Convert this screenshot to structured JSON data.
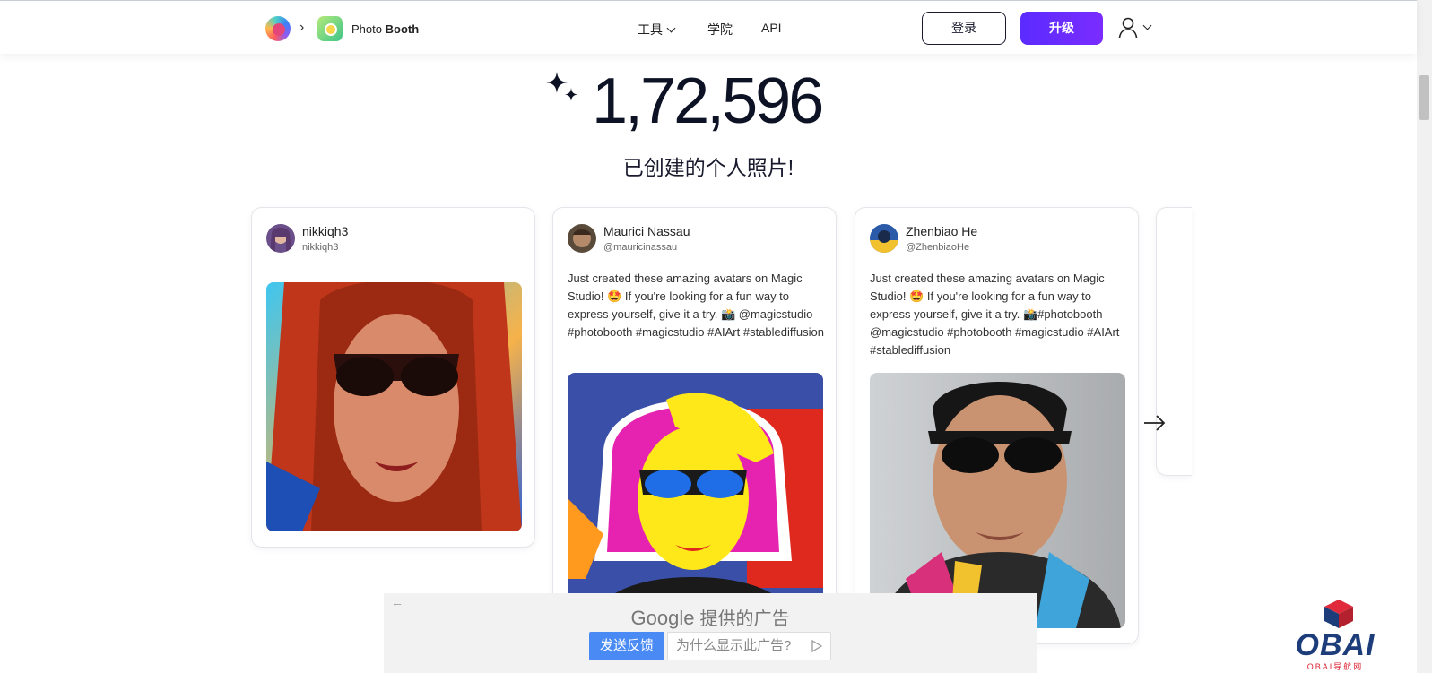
{
  "header": {
    "app_name_prefix": "Photo",
    "app_name_bold": "Booth",
    "nav": {
      "tools": "工具",
      "academy": "学院",
      "api": "API"
    },
    "login": "登录",
    "upgrade": "升级"
  },
  "hero": {
    "counter": "1,72,596",
    "subtitle": "已创建的个人照片!"
  },
  "cards": [
    {
      "name": "nikkiqh3",
      "handle": "nikkiqh3",
      "text": ""
    },
    {
      "name": "Maurici Nassau",
      "handle": "@mauricinassau",
      "text": "Just created these amazing avatars on Magic Studio! 🤩 If you're looking for a fun way to express yourself, give it a try. 📸 @magicstudio #photobooth #magicstudio #AIArt #stablediffusion"
    },
    {
      "name": "Zhenbiao He",
      "handle": "@ZhenbiaoHe",
      "text": "Just created these amazing avatars on Magic Studio! 🤩 If you're looking for a fun way to express yourself, give it a try. 📸#photobooth @magicstudio #photobooth #magicstudio #AIArt #stablediffusion"
    }
  ],
  "ad": {
    "google": "Google",
    "title": "提供的广告",
    "feedback": "发送反馈",
    "why": "为什么显示此广告?"
  },
  "watermark": {
    "text": "OBAI",
    "sub": "OBAI导航网"
  },
  "colors": {
    "upgrade": "#5b2bff",
    "feedback": "#4a8af4",
    "watermark": "#1c3d7a"
  }
}
